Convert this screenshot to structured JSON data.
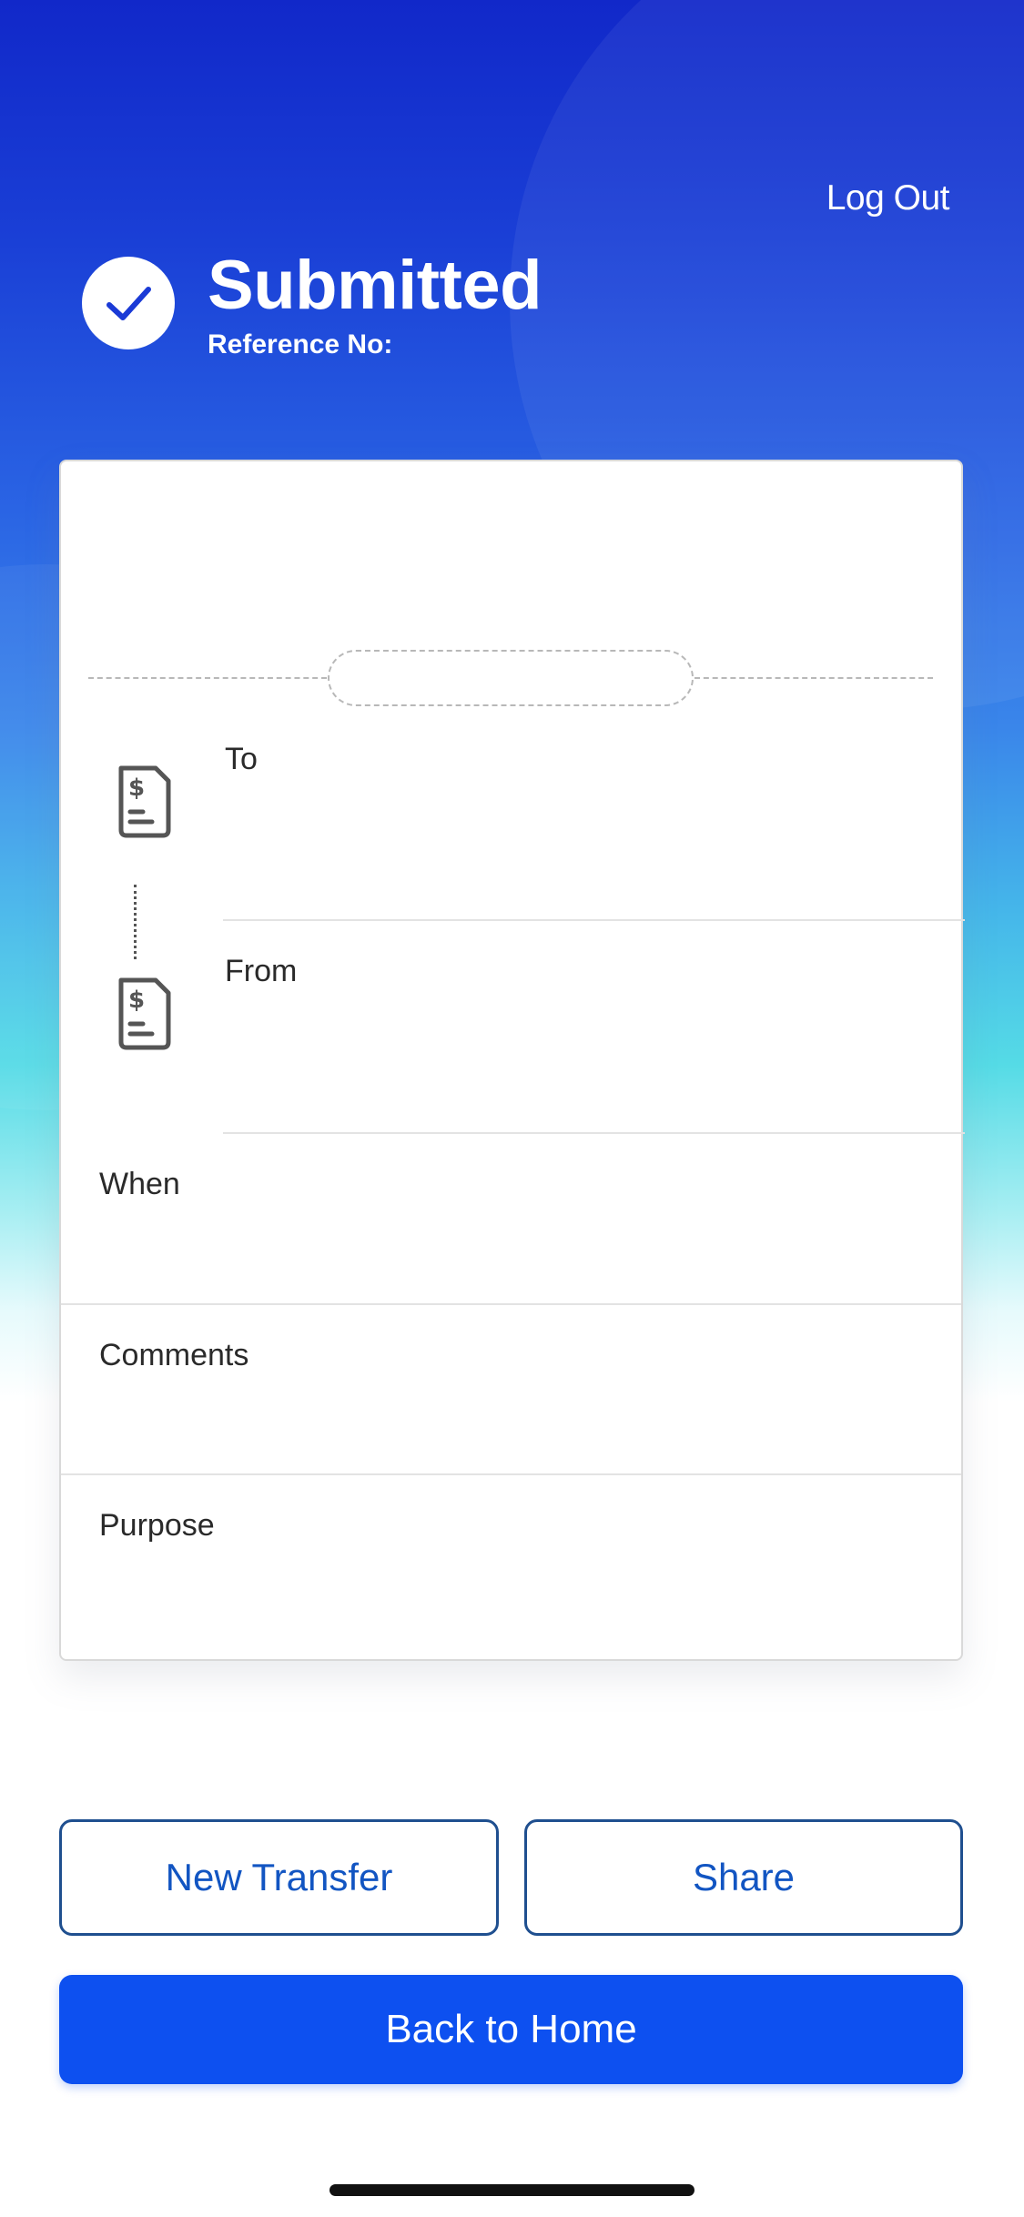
{
  "header": {
    "logout_label": "Log Out",
    "title": "Submitted",
    "reference_label": "Reference No:"
  },
  "details": {
    "to_label": "To",
    "from_label": "From",
    "when_label": "When",
    "comments_label": "Comments",
    "purpose_label": "Purpose"
  },
  "actions": {
    "new_transfer_label": "New Transfer",
    "share_label": "Share",
    "back_home_label": "Back to Home"
  },
  "icons": {
    "success": "checkmark-icon",
    "account": "document-dollar-icon"
  },
  "colors": {
    "primary": "#0d50f0",
    "outline_button_text": "#1255c2",
    "header_gradient_top": "#1128c9"
  }
}
